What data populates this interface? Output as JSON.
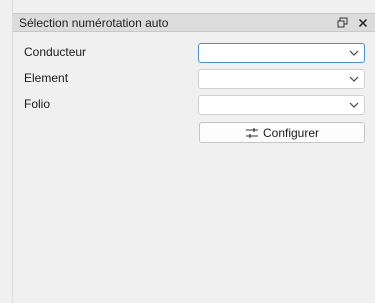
{
  "panel": {
    "title": "Sélection numérotation auto"
  },
  "form": {
    "rows": [
      {
        "label": "Conducteur",
        "value": ""
      },
      {
        "label": "Element",
        "value": ""
      },
      {
        "label": "Folio",
        "value": ""
      }
    ],
    "configure_label": "Configurer"
  },
  "icons": {
    "float": "float-window-icon",
    "close": "close-icon",
    "dropdown": "chevron-down-icon",
    "configure": "sliders-icon"
  },
  "colors": {
    "background": "#f0f0f0",
    "titlebar": "#dcdcdc",
    "focus_border": "#4a90d9"
  }
}
